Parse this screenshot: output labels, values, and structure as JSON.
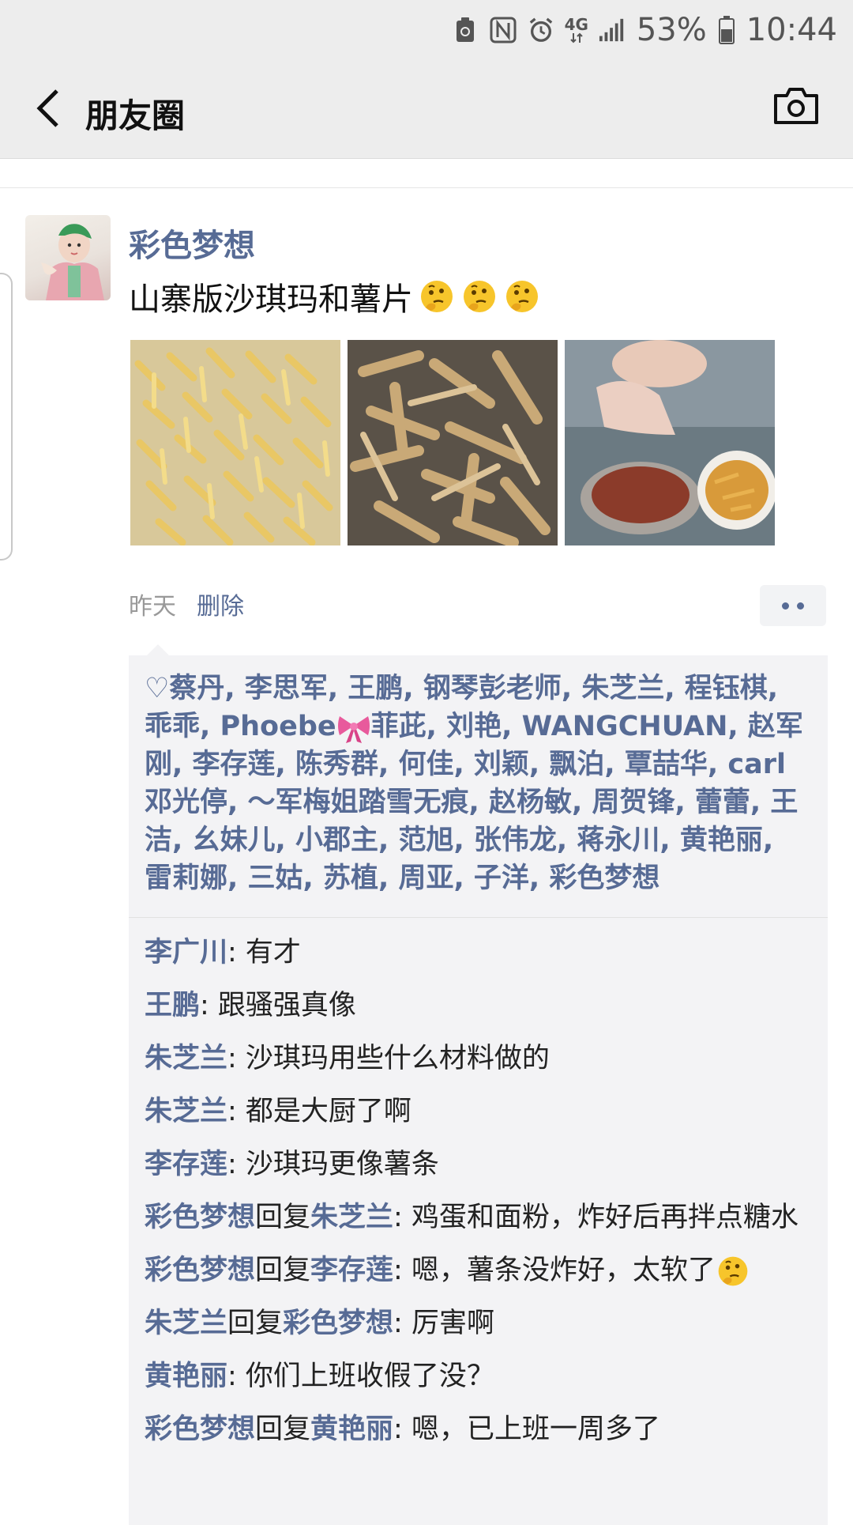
{
  "status_bar": {
    "network": "4G",
    "battery": "53%",
    "time": "10:44"
  },
  "nav": {
    "title": "朋友圈"
  },
  "post": {
    "author": "彩色梦想",
    "text": "山寨版沙琪玛和薯片",
    "time": "昨天",
    "delete_label": "删除",
    "photos": [
      "fries-tray-photo",
      "fried-strips-plate-photo",
      "child-eating-photo"
    ],
    "likes_text_1": "蔡丹, 李思军, 王鹏, 钢琴彭老师, 朱芝兰, 程钰棋, 乖乖, Phoebe",
    "likes_text_2": "菲茈, 刘艳, WANGCHUAN, 赵军刚, 李存莲, 陈秀群, 何佳, 刘颖, 飘泊, 覃喆华, carl邓光停, ～军梅姐踏雪无痕, 赵杨敏, 周贺锋, 蕾蕾, 王洁, 幺妹儿, 小郡主, 范旭, 张伟龙, 蒋永川, 黄艳丽, 雷莉娜, 三姑, 苏植, 周亚, 子洋, 彩色梦想",
    "comments": [
      {
        "name": "李广川",
        "reply_word": "",
        "reply_to": "",
        "text": ": 有才"
      },
      {
        "name": "王鹏",
        "reply_word": "",
        "reply_to": "",
        "text": ": 跟骚强真像"
      },
      {
        "name": "朱芝兰",
        "reply_word": "",
        "reply_to": "",
        "text": ": 沙琪玛用些什么材料做的"
      },
      {
        "name": "朱芝兰",
        "reply_word": "",
        "reply_to": "",
        "text": ": 都是大厨了啊"
      },
      {
        "name": "李存莲",
        "reply_word": "",
        "reply_to": "",
        "text": ": 沙琪玛更像薯条"
      },
      {
        "name": "彩色梦想",
        "reply_word": "回复",
        "reply_to": "朱芝兰",
        "text": ": 鸡蛋和面粉，炸好后再拌点糖水"
      },
      {
        "name": "彩色梦想",
        "reply_word": "回复",
        "reply_to": "李存莲",
        "text": ": 嗯，薯条没炸好，太软了"
      },
      {
        "name": "朱芝兰",
        "reply_word": "回复",
        "reply_to": "彩色梦想",
        "text": ": 厉害啊"
      },
      {
        "name": "黄艳丽",
        "reply_word": "",
        "reply_to": "",
        "text": ": 你们上班收假了没？"
      },
      {
        "name": "彩色梦想",
        "reply_word": "回复",
        "reply_to": "黄艳丽",
        "text": ": 嗯，已上班一周多了"
      }
    ]
  },
  "colors": {
    "link_blue": "#576b95",
    "bar_bg": "#ededed",
    "box_bg": "#f3f3f5"
  }
}
